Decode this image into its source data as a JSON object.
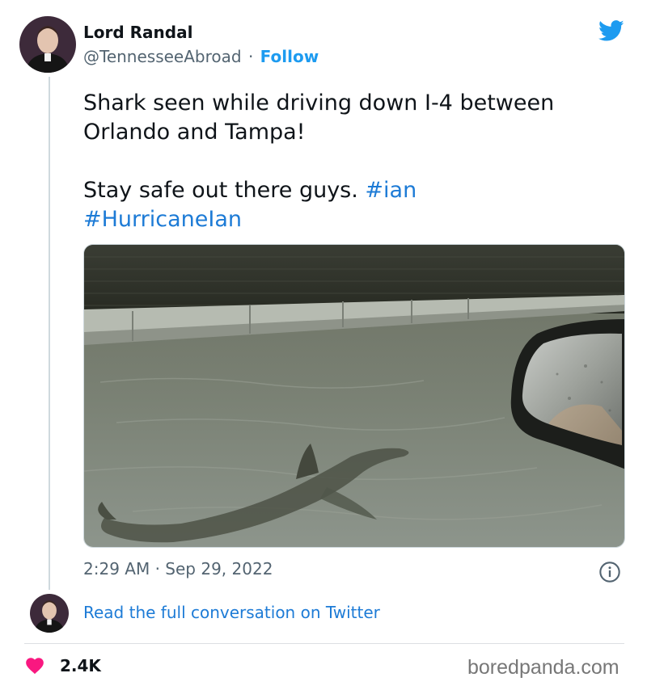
{
  "tweet": {
    "author_name": "Lord Randal",
    "handle": "@TennesseeAbroad",
    "separator": "·",
    "follow_label": "Follow",
    "text_line1": "Shark seen while driving down I-4 between Orlando and Tampa!",
    "text_line2_prefix": "Stay safe out there guys. ",
    "hashtag1": "#ian",
    "hashtag2": "#HurricaneIan",
    "time": "2:29 AM",
    "date": "Sep 29, 2022",
    "read_link": "Read the full conversation on Twitter",
    "likes": "2.4K"
  },
  "watermark": "boredpanda.com",
  "icons": {
    "brand": "twitter-bird-icon",
    "info": "info-icon",
    "like": "heart-icon"
  },
  "colors": {
    "link": "#1d7bd6",
    "follow": "#1d9bf0",
    "twitter_brand": "#1d9bf0",
    "heart": "#f91880",
    "muted": "#536471"
  }
}
